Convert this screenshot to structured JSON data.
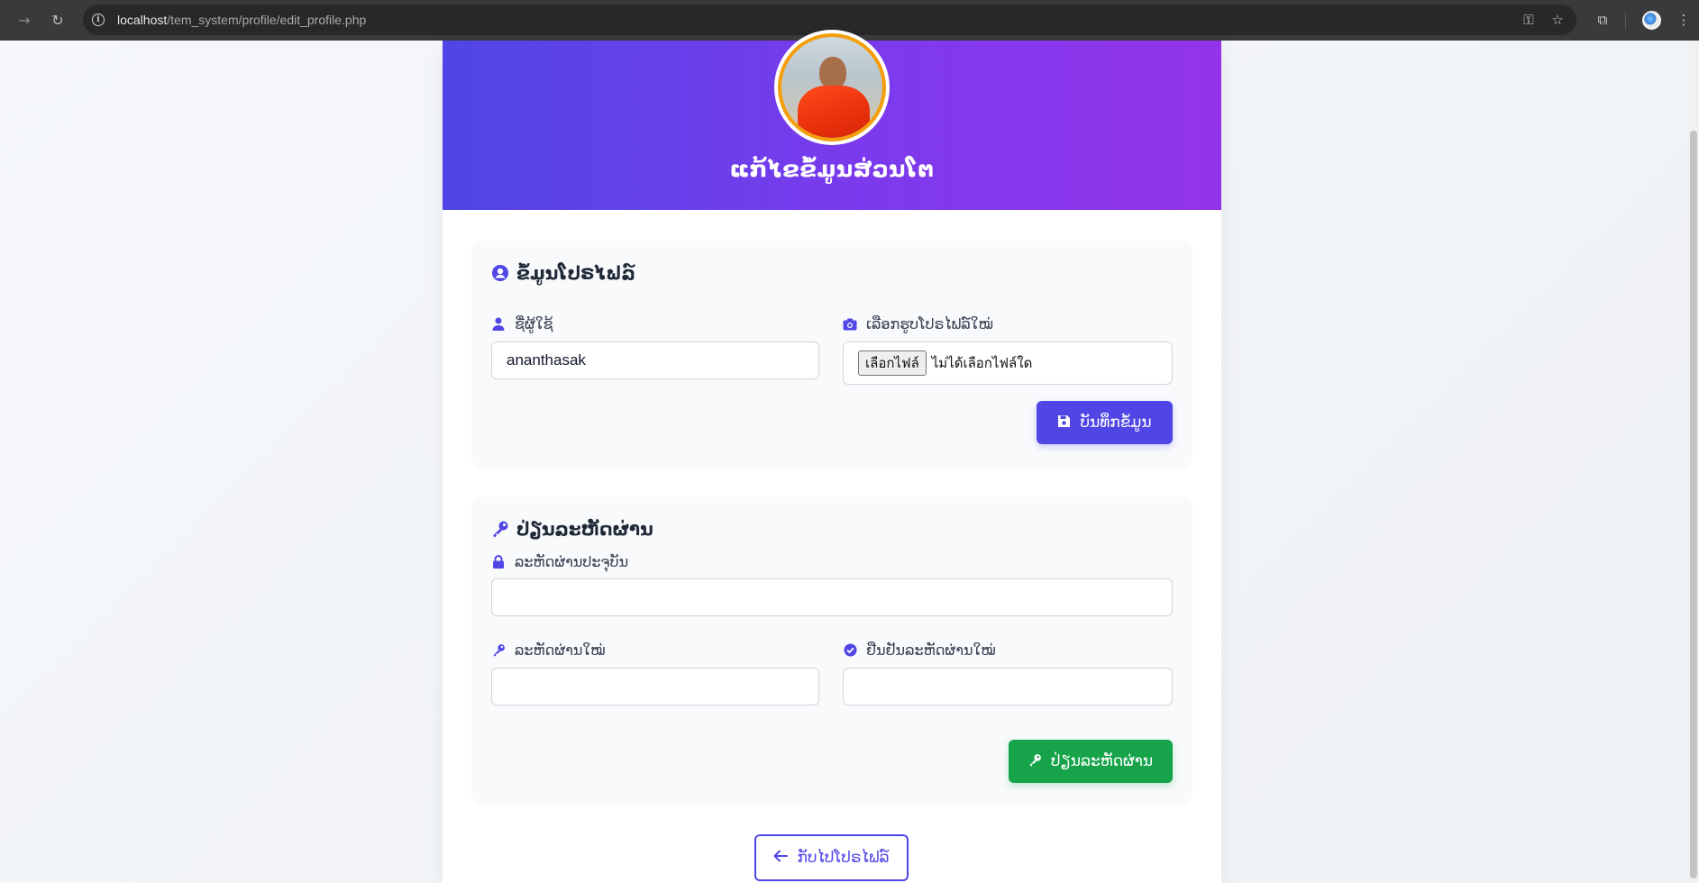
{
  "browser": {
    "url_host": "localhost",
    "url_path": "/tem_system/profile/edit_profile.php"
  },
  "header": {
    "title": "ແກ້ໄຂຂໍ້ມູນສ່ວນໂຕ"
  },
  "profile_section": {
    "title": "ຂໍ້ມູນໂປຣໄຟລ໌",
    "username_label": "ຊື່ຜູ້ໃຊ້",
    "username_value": "ananthasak",
    "photo_label": "ເລືອກຮູບໂປຣໄຟລ໌ໃໝ່",
    "file_button": "เลือกไฟล์",
    "file_status": "ไม่ได้เลือกไฟล์ใด",
    "save_button": "ບັນທຶກຂໍ້ມູນ"
  },
  "password_section": {
    "title": "ປ່ຽນລະຫັດຜ່ານ",
    "current_label": "ລະຫັດຜ່ານປະຈຸບັນ",
    "new_label": "ລະຫັດຜ່ານໃໝ່",
    "confirm_label": "ຢືນຢັນລະຫັດຜ່ານໃໝ່",
    "change_button": "ປ່ຽນລະຫັດຜ່ານ"
  },
  "back_button": "ກັບໄປໂປຣໄຟລ໌",
  "colors": {
    "primary": "#4f46e5",
    "gradient_end": "#9333ea",
    "success": "#16a34a",
    "avatar_ring": "#f59e0b"
  }
}
